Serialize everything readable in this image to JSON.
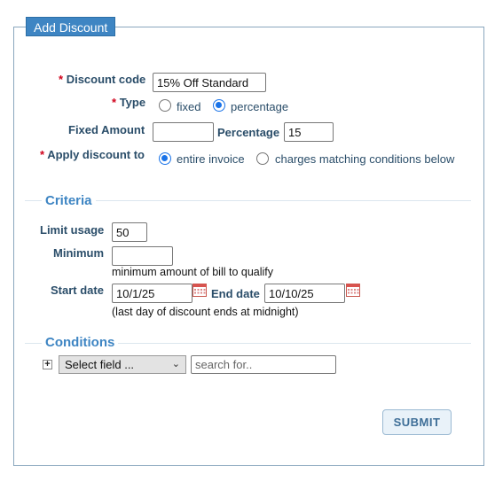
{
  "form": {
    "title": "Add Discount",
    "required_marker": "*",
    "discount_code": {
      "label": "Discount code",
      "value": "15% Off Standard"
    },
    "type": {
      "label": "Type",
      "options": [
        "fixed",
        "percentage"
      ],
      "selected": "percentage"
    },
    "fixed_amount": {
      "label": "Fixed Amount",
      "value": ""
    },
    "percentage": {
      "label": "Percentage",
      "value": "15"
    },
    "apply_to": {
      "label": "Apply discount to",
      "options": [
        "entire invoice",
        "charges matching conditions below"
      ],
      "selected": "entire invoice"
    }
  },
  "criteria": {
    "title": "Criteria",
    "limit_usage": {
      "label": "Limit usage",
      "value": "50"
    },
    "minimum": {
      "label": "Minimum",
      "value": "",
      "help": "minimum amount of bill to qualify"
    },
    "start_date": {
      "label": "Start date",
      "value": "10/1/25"
    },
    "end_date": {
      "label": "End date",
      "value": "10/10/25"
    },
    "date_note": "(last day of discount ends at midnight)"
  },
  "conditions": {
    "title": "Conditions",
    "add_icon": "plus-icon",
    "field_select": "Select field ...",
    "search_placeholder": "search for.."
  },
  "submit_label": "SUBMIT",
  "colors": {
    "accent": "#3e85c3",
    "label": "#2a4d69",
    "required": "#d0021b",
    "radio": "#1a73e8"
  }
}
